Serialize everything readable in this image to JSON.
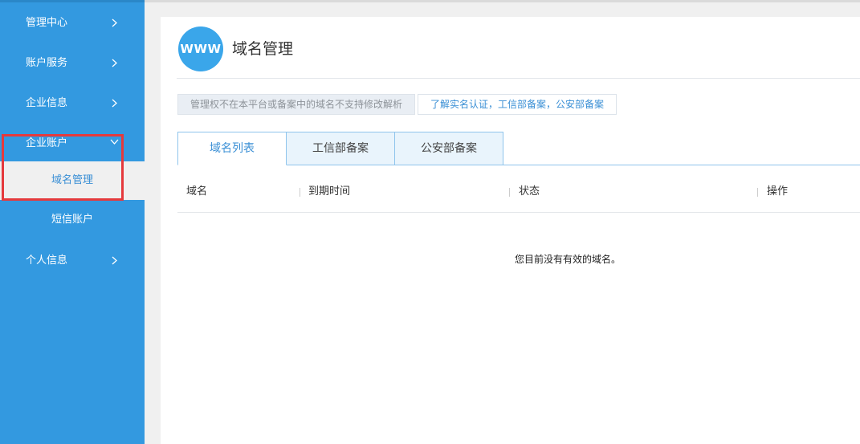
{
  "sidebar": {
    "items": [
      {
        "label": "管理中心"
      },
      {
        "label": "账户服务"
      },
      {
        "label": "企业信息"
      },
      {
        "label": "企业账户"
      },
      {
        "label": "个人信息"
      }
    ],
    "sub_items": [
      {
        "label": "域名管理",
        "active": true
      },
      {
        "label": "短信账户",
        "active": false
      }
    ]
  },
  "header": {
    "logo_text": "WWW",
    "title": "域名管理"
  },
  "notices": {
    "info": "管理权不在本平台或备案中的域名不支持修改解析",
    "link": "了解实名认证，工信部备案，公安部备案"
  },
  "tabs": [
    {
      "label": "域名列表",
      "active": true
    },
    {
      "label": "工信部备案",
      "active": false
    },
    {
      "label": "公安部备案",
      "active": false
    }
  ],
  "table": {
    "columns": [
      "域名",
      "到期时间",
      "状态",
      "操作"
    ],
    "rows": [],
    "empty_message": "您目前没有有效的域名。"
  },
  "colors": {
    "sidebar_bg": "#3399e0",
    "accent": "#3a8fd5",
    "highlight": "#e5393c"
  }
}
